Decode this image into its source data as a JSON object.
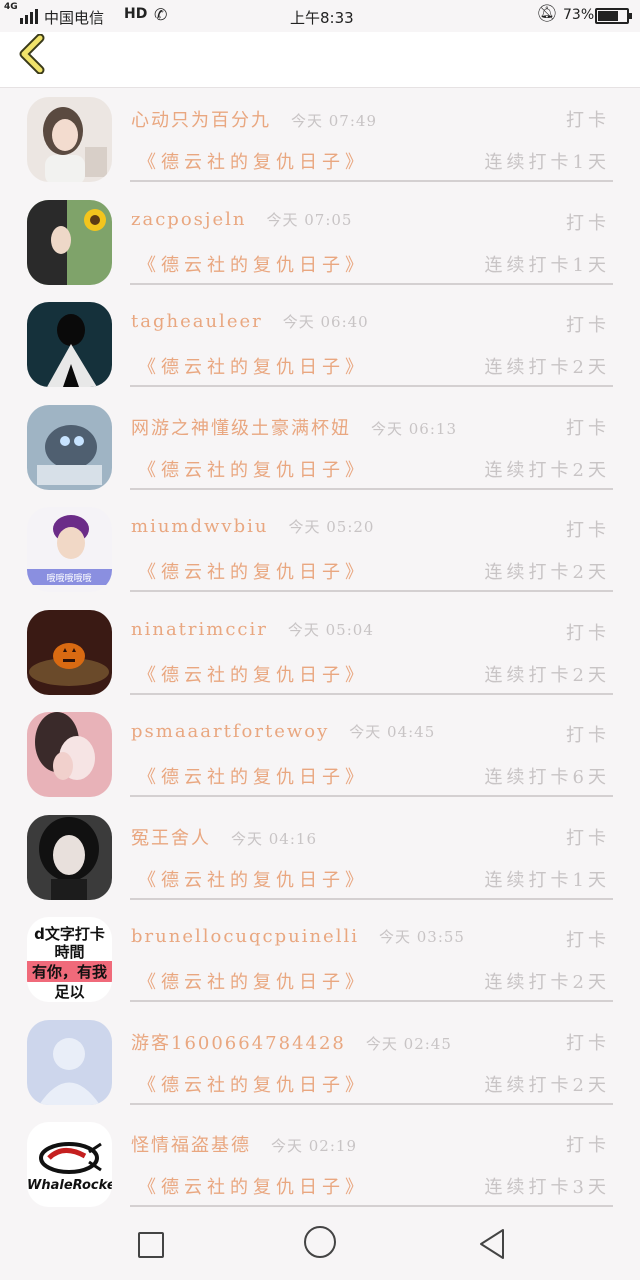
{
  "status_bar": {
    "network": "4G",
    "carrier": "中国电信",
    "hd": "HD",
    "time": "上午8:33",
    "battery": "73%",
    "battery_level": 0.73
  },
  "nav": {
    "back_icon": "chevron-left-icon"
  },
  "items": [
    {
      "name": "心动只为百分九",
      "time": "今天 07:49",
      "action": "打卡",
      "book": "《德云社的复仇日子》",
      "streak": "连续打卡1天",
      "avatar": "girl-photo"
    },
    {
      "name": "zacposjeln",
      "time": "今天 07:05",
      "action": "打卡",
      "book": "《德云社的复仇日子》",
      "streak": "连续打卡1天",
      "avatar": "girl-sunflower-photo"
    },
    {
      "name": "tagheauleer",
      "time": "今天 06:40",
      "action": "打卡",
      "book": "《德云社的复仇日子》",
      "streak": "连续打卡2天",
      "avatar": "dark-figure-photo"
    },
    {
      "name": "网游之神懂级土豪满杯妞",
      "time": "今天 06:13",
      "action": "打卡",
      "book": "《德云社的复仇日子》",
      "streak": "连续打卡2天",
      "avatar": "game-robot-art"
    },
    {
      "name": "miumdwvbiu",
      "time": "今天 05:20",
      "action": "打卡",
      "book": "《德云社的复仇日子》",
      "streak": "连续打卡2天",
      "avatar": "boy-photo"
    },
    {
      "name": "ninatrimccir",
      "time": "今天 05:04",
      "action": "打卡",
      "book": "《德云社的复仇日子》",
      "streak": "连续打卡2天",
      "avatar": "pumpkin-photo"
    },
    {
      "name": "psmaaartfortewoy",
      "time": "今天 04:45",
      "action": "打卡",
      "book": "《德云社的复仇日子》",
      "streak": "连续打卡6天",
      "avatar": "pink-girl-photo"
    },
    {
      "name": "冤王舍人",
      "time": "今天 04:16",
      "action": "打卡",
      "book": "《德云社的复仇日子》",
      "streak": "连续打卡1天",
      "avatar": "dark-hair-girl-photo"
    },
    {
      "name": "brunellocuqcpuinelli",
      "time": "今天 03:55",
      "action": "打卡",
      "book": "《德云社的复仇日子》",
      "streak": "连续打卡2天",
      "avatar": "text-image",
      "avatar_lines": [
        "d文字打卡",
        "時間",
        "有你，有我",
        "足以"
      ]
    },
    {
      "name": "游客1600664784428",
      "time": "今天 02:45",
      "action": "打卡",
      "book": "《德云社的复仇日子》",
      "streak": "连续打卡2天",
      "avatar": "default-user-icon"
    },
    {
      "name": "怪情福盗基德",
      "time": "今天 02:19",
      "action": "打卡",
      "book": "《德云社的复仇日子》",
      "streak": "连续打卡3天",
      "avatar": "whalerocket-logo",
      "avatar_logo_text": "WhaleRocket"
    }
  ],
  "system_nav": {
    "recent_icon": "square-icon",
    "home_icon": "circle-icon",
    "back_icon": "triangle-back-icon"
  }
}
